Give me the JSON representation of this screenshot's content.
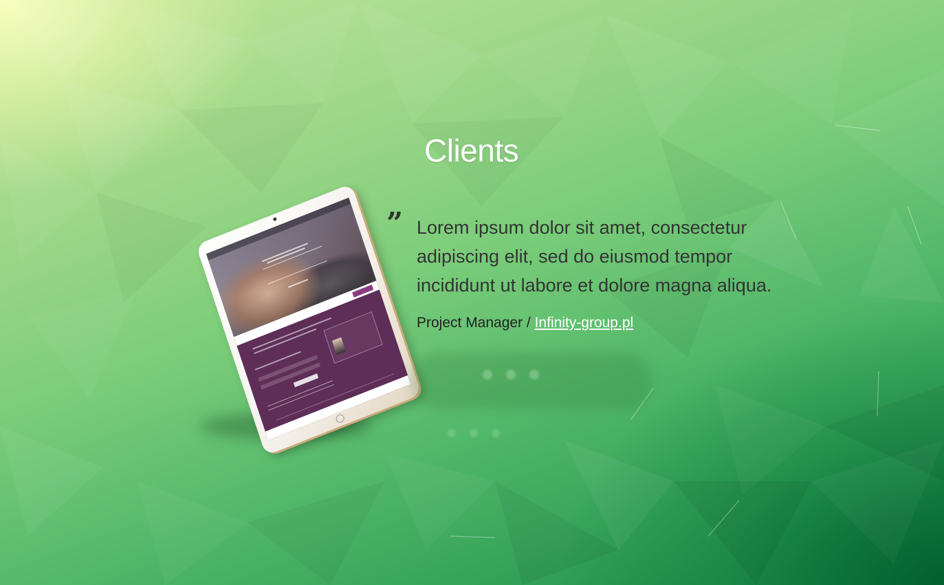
{
  "section": {
    "title": "Clients"
  },
  "testimonial": {
    "quote_mark": "”",
    "text": "Lorem ipsum dolor sit amet, consectetur adipiscing elit, sed do eiusmod tempor incididunt ut labore et dolore magna aliqua.",
    "role": "Project Manager / ",
    "company_link": "Infinity-group.pl"
  },
  "colors": {
    "title": "#ffffff",
    "body_text": "#333333",
    "link": "#ffffff",
    "background_light": "#f4fbb8",
    "background_dark": "#006a32",
    "tablet_screen_accent": "#5e2d58"
  },
  "icons": {
    "quote": "closing-quote-icon"
  }
}
